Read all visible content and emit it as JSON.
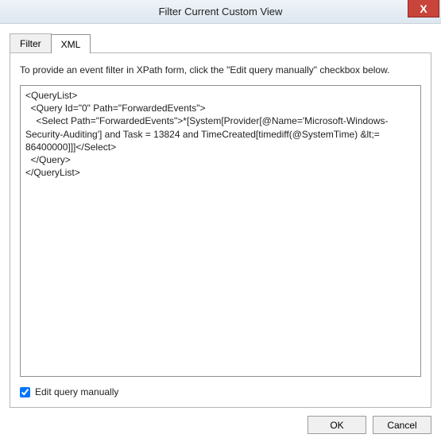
{
  "titlebar": {
    "title": "Filter Current Custom View",
    "close_glyph": "X"
  },
  "tabs": {
    "filter": {
      "label": "Filter"
    },
    "xml": {
      "label": "XML"
    }
  },
  "panel": {
    "instruction": "To provide an event filter in XPath form, click the \"Edit query manually\" checkbox below.",
    "query_text": "<QueryList>\n  <Query Id=\"0\" Path=\"ForwardedEvents\">\n    <Select Path=\"ForwardedEvents\">*[System[Provider[@Name='Microsoft-Windows-Security-Auditing'] and Task = 13824 and TimeCreated[timediff(@SystemTime) &lt;= 86400000]]]</Select>\n  </Query>\n</QueryList>",
    "edit_manually_label": "Edit query manually",
    "edit_manually_checked": true
  },
  "buttons": {
    "ok": "OK",
    "cancel": "Cancel"
  }
}
